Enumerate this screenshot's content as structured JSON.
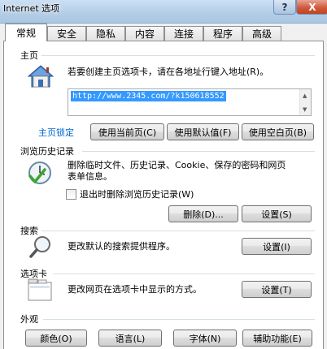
{
  "window": {
    "title": "Internet 选项",
    "help_symbol": "?",
    "close_symbol": "X"
  },
  "tabs": [
    "常规",
    "安全",
    "隐私",
    "内容",
    "连接",
    "程序",
    "高级"
  ],
  "home": {
    "section_title": "主页",
    "instruction": "若要创建主页选项卡，请在各地址行键入地址(R)。",
    "url": "http://www.2345.com/?k150618552",
    "lock_link": "主页锁定",
    "btn_current": "使用当前页(C)",
    "btn_default": "使用默认值(F)",
    "btn_blank": "使用空白页(B)",
    "icon": "house-icon"
  },
  "history": {
    "section_title": "浏览历史记录",
    "description_line1": "删除临时文件、历史记录、Cookie、保存的密码和网页",
    "description_line2": "表单信息。",
    "checkbox_label": "退出时删除浏览历史记录(W)",
    "checkbox_checked": false,
    "btn_delete": "删除(D)...",
    "btn_settings": "设置(S)",
    "icon": "clock-check-icon"
  },
  "search": {
    "section_title": "搜索",
    "description": "更改默认的搜索提供程序。",
    "btn_settings": "设置(I)",
    "icon": "magnifier-icon"
  },
  "tabs_section": {
    "section_title": "选项卡",
    "description": "更改网页在选项卡中显示的方式。",
    "btn_settings": "设置(T)",
    "icon": "tabbed-window-icon"
  },
  "appearance": {
    "section_title": "外观",
    "btn_colors": "颜色(O)",
    "btn_languages": "语言(L)",
    "btn_fonts": "字体(N)",
    "btn_accessibility": "辅助功能(E)"
  }
}
